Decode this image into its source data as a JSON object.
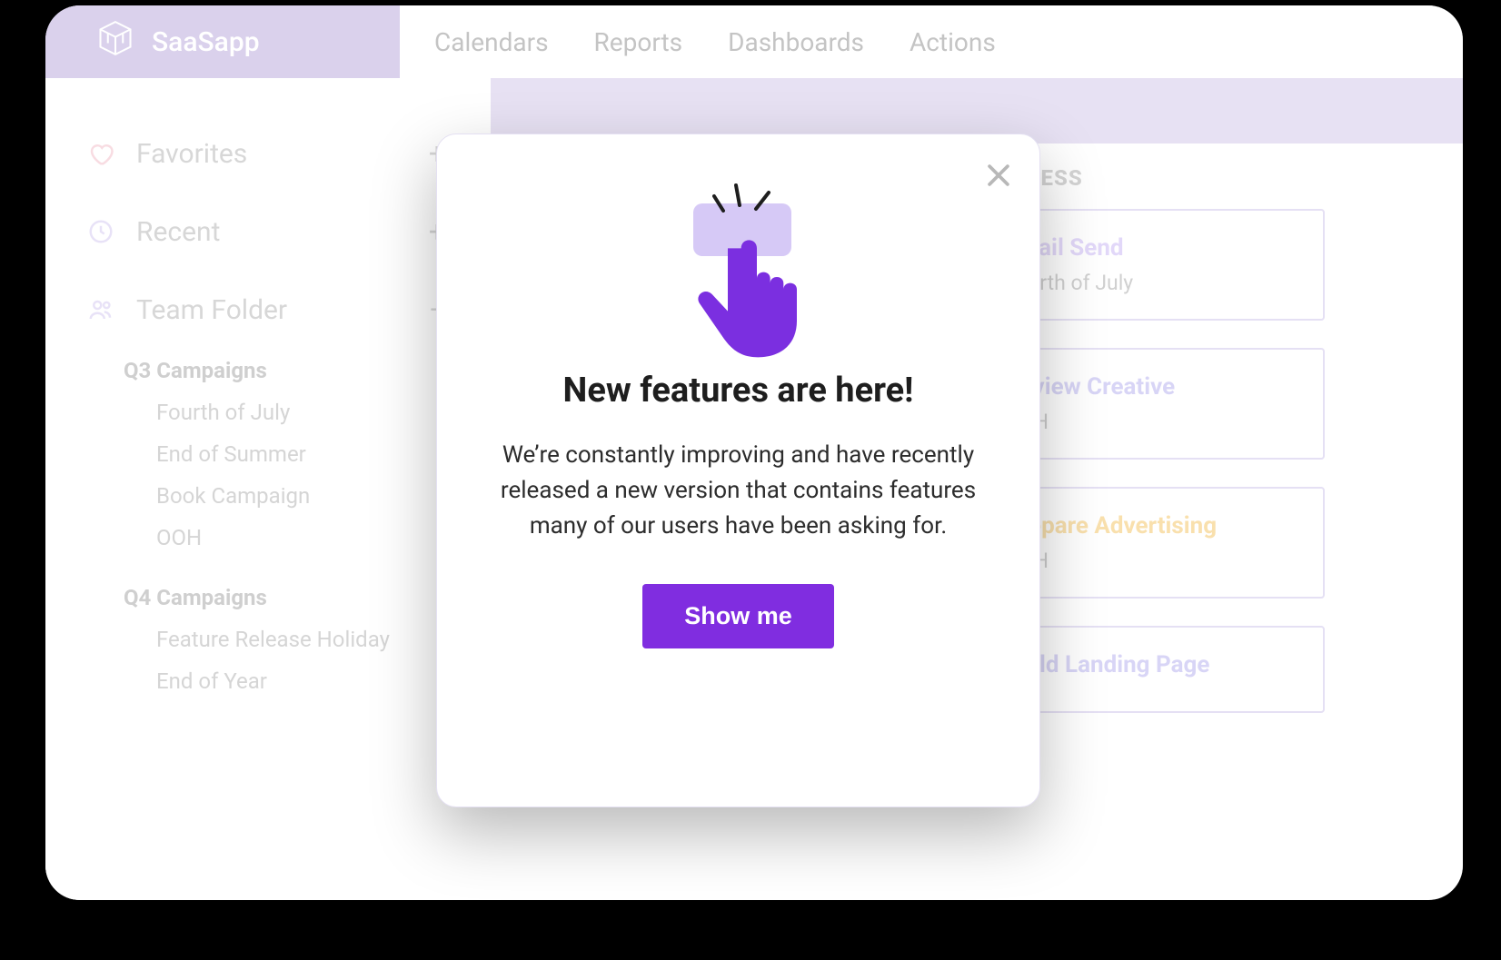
{
  "header": {
    "brand": "SaaSapp",
    "nav": [
      {
        "label": "Calendars"
      },
      {
        "label": "Reports"
      },
      {
        "label": "Dashboards"
      },
      {
        "label": "Actions"
      }
    ]
  },
  "sidebar": {
    "favorites": {
      "label": "Favorites",
      "action": "+"
    },
    "recent": {
      "label": "Recent",
      "action": "+"
    },
    "team_folder": {
      "label": "Team Folder",
      "action": "−"
    },
    "groups": [
      {
        "heading": "Q3 Campaigns",
        "items": [
          {
            "label": "Fourth of July"
          },
          {
            "label": "End of Summer"
          },
          {
            "label": "Book Campaign"
          },
          {
            "label": "OOH"
          }
        ]
      },
      {
        "heading": "Q4 Campaigns",
        "items": [
          {
            "label": "Feature Release Holiday"
          },
          {
            "label": "End of Year"
          }
        ]
      }
    ]
  },
  "board": {
    "columns": [
      {
        "title": "",
        "cards": [
          {
            "blank": true
          },
          {
            "blank": true
          }
        ]
      },
      {
        "title": "IN PROGRESS",
        "cards": [
          {
            "title": "Email Send",
            "sub": "Fourth of July",
            "color": "#CBB8F4",
            "title_color": "#CBB8F4"
          },
          {
            "title": "Review Creative",
            "sub": "OOH",
            "color": "#B9B2EE",
            "title_color": "#B9B2EE"
          },
          {
            "title": "Prepare Advertising",
            "sub": "OOH",
            "color": "#F4C66A",
            "title_color": "#F4C66A"
          },
          {
            "title": "Build Landing Page",
            "sub": "",
            "color": "#B9B2EE",
            "title_color": "#B9B2EE"
          }
        ]
      }
    ]
  },
  "modal": {
    "title": "New features are here!",
    "body": "We’re constantly improving and have recently released a new version that contains features many of our users have been asking for.",
    "button": "Show me"
  }
}
